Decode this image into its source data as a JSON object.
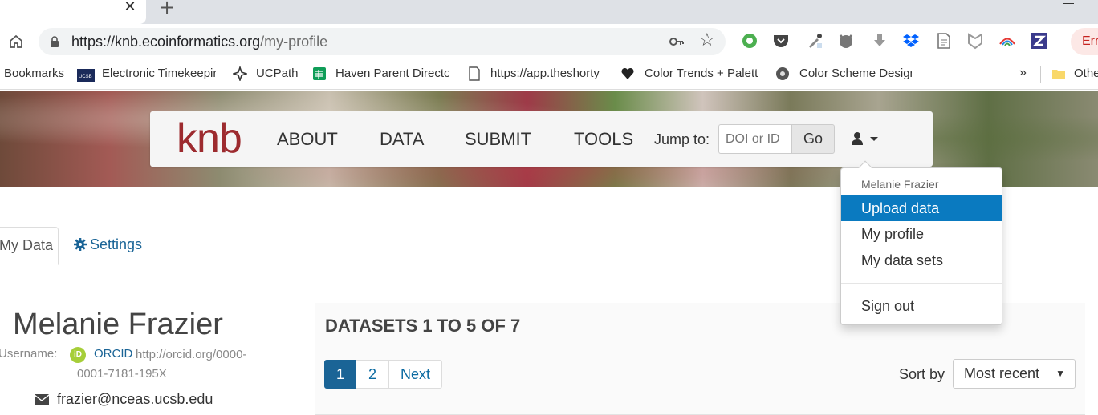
{
  "browser": {
    "tab_close": "✕",
    "new_tab": "+",
    "url_host": "https://knb.ecoinformatics.org",
    "url_path": "/my-profile",
    "error_pill": "Err"
  },
  "bookmarks": [
    {
      "label": "Bookmarks"
    },
    {
      "label": "Electronic Timekeepir"
    },
    {
      "label": "UCPath"
    },
    {
      "label": "Haven Parent Directo"
    },
    {
      "label": "https://app.theshorty"
    },
    {
      "label": "Color Trends + Palett"
    },
    {
      "label": "Color Scheme Design"
    },
    {
      "label": "Othe"
    }
  ],
  "bookmarks_more": "»",
  "navbar": {
    "logo": "knb",
    "links": [
      "ABOUT",
      "DATA",
      "SUBMIT",
      "TOOLS"
    ],
    "jump_label": "Jump to:",
    "doi_placeholder": "DOI or ID",
    "go": "Go"
  },
  "user_menu": {
    "header": "Melanie Frazier",
    "items": [
      "Upload data",
      "My profile",
      "My data sets"
    ],
    "signout": "Sign out"
  },
  "tabs": {
    "my_data": "My Data",
    "settings": "Settings"
  },
  "profile": {
    "name": "Melanie Frazier",
    "username_label": "Username:",
    "orcid_badge": "iD",
    "orcid_label": "ORCID",
    "orcid_url_1": "http://orcid.org/0000-",
    "orcid_url_2": "0001-7181-195X",
    "email": "frazier@nceas.ucsb.edu"
  },
  "datasets": {
    "title": "DATASETS 1 TO 5 OF 7",
    "pages": [
      "1",
      "2",
      "Next"
    ],
    "sort_label": "Sort by",
    "sort_value": "Most recent",
    "sort_caret": "▼"
  }
}
